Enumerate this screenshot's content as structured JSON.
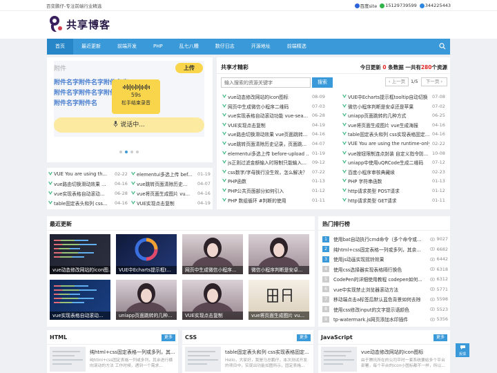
{
  "topbar": {
    "slogan": "百变鹏仔-专注前端行业精选",
    "baidu": "百度site",
    "wechat": "15129739599",
    "qq": "344225443"
  },
  "logo": {
    "text": "共享博客"
  },
  "nav": {
    "items": [
      "首页",
      "最近更新",
      "前端开发",
      "PHP",
      "乱七八糟",
      "数仔日志",
      "开源地址",
      "前端精选"
    ],
    "active_index": 0
  },
  "slider": {
    "attach_title": "附件",
    "attach_lines": [
      "附件名字附件名字附件名字",
      "附件名字附件名字附件",
      "附件名字附件名"
    ],
    "upload_label": "上传",
    "rec_time": "59s",
    "rec_hint": "松手结束录音",
    "talk_label": "说话中...",
    "dots": 4,
    "active_dot": 1
  },
  "mini_list": [
    {
      "title": "VUE You are using th...",
      "date": "02-22"
    },
    {
      "title": "elementui多选上传 bef...",
      "date": "01-19"
    },
    {
      "title": "vue路由切换滑动效果 ...",
      "date": "04-16"
    },
    {
      "title": "vue跳转页面清除历史...",
      "date": "04-07"
    },
    {
      "title": "vue实现表格自动滚动...",
      "date": "06-28"
    },
    {
      "title": "vue将页面生成图片 vu...",
      "date": "04-16"
    },
    {
      "title": "table固定表头和列 css...",
      "date": "04-16"
    },
    {
      "title": "VUE实现点击复制",
      "date": "04-19"
    }
  ],
  "share": {
    "title": "共享才精彩",
    "stat_pre": "今日更新 ",
    "stat_today": "0",
    "stat_mid": " 条数据 一共有",
    "stat_total": "280",
    "stat_post": "个资源",
    "search_placeholder": "输入搜索的资源关键字",
    "search_button": "搜索",
    "prev": "上一页",
    "page": "1/5",
    "next": "下一页",
    "left_items": [
      {
        "title": "vue动态修改网站的icon图标",
        "date": "08-09"
      },
      {
        "title": "网页中生成微信小程序二维码",
        "date": "07-03"
      },
      {
        "title": "vue实现表格自动滚动功能 vue-sea...",
        "date": "06-28"
      },
      {
        "title": "VUE实现点击复制",
        "date": "04-19"
      },
      {
        "title": "vue路由切换滑动效果 vue页面跳转...",
        "date": "04-16"
      },
      {
        "title": "vue跳转页面清除历史记录，页面跳...",
        "date": "04-07"
      },
      {
        "title": "elementui多选上传 before-upload ...",
        "date": "01-19"
      },
      {
        "title": "js正则过滤金额输入时限制只能输入...",
        "date": "09-12"
      },
      {
        "title": "css数字/字母换行没生效，怎么解决？",
        "date": "07-22"
      },
      {
        "title": "PHP函数",
        "date": "01-13"
      },
      {
        "title": "PHP公共页面部分如何引入",
        "date": "01-12"
      },
      {
        "title": "PHP 数组循环 #判断的使用",
        "date": "01-11"
      }
    ],
    "right_items": [
      {
        "title": "VUE中Echarts提示框tooltip自动切换",
        "date": "07-08"
      },
      {
        "title": "微信小程序判断是安卓还是苹果",
        "date": "07-02"
      },
      {
        "title": "uniapp页面跳转的几种方式",
        "date": "06-25"
      },
      {
        "title": "vue将页面生成图片 vue生成海报",
        "date": "04-16"
      },
      {
        "title": "table固定表头和列 css实现表格固定...",
        "date": "04-16"
      },
      {
        "title": "VUE You are using the runtime-only...",
        "date": "02-22"
      },
      {
        "title": "vue按钮限制连点封装 自定义指令防...",
        "date": "10-08"
      },
      {
        "title": "uniapp中使用uQRCode生成二维码",
        "date": "07-12"
      },
      {
        "title": "百度小程序审核典藏续",
        "date": "02-23"
      },
      {
        "title": "PHP 字符串函数",
        "date": "01-13"
      },
      {
        "title": "http请求类型 POST请求",
        "date": "01-12"
      },
      {
        "title": "http请求类型 GET请求",
        "date": "01-11"
      }
    ]
  },
  "latest": {
    "title": "最近更新",
    "thumbs": [
      "vue动态修改网站的icon图...",
      "VUE中Echarts提示框t...",
      "网页中生成微信小程序...",
      "微信小程序判断是安卓...",
      "vue实现表格自动滚动...",
      "uniapp页面跳转的几种...",
      "VUE实现点击复制",
      "vue将页面生成图片 vu..."
    ]
  },
  "hot": {
    "title": "热门排行榜",
    "items": [
      {
        "title": "使用bat自动执行cmd命令（多个命令或...",
        "count": "9027"
      },
      {
        "title": "纯html+css固定表格一列或多列，其余...",
        "count": "6682"
      },
      {
        "title": "使用js动画实现摇铃效果",
        "count": "6442"
      },
      {
        "title": "使用css选择器实现表格隔行换色",
        "count": "6318"
      },
      {
        "title": "CodePen的详细使用教程 codepen如何...",
        "count": "6312"
      },
      {
        "title": "vue中实现禁止浏览器滚动方法",
        "count": "5771"
      },
      {
        "title": "移动端点击a标签后默认蓝色背景如何去除",
        "count": "5598"
      },
      {
        "title": "使用css修改input的文字提示语颜色",
        "count": "5523"
      },
      {
        "title": "tp-watermark.js网页添加水印插件",
        "count": "5356"
      }
    ]
  },
  "bottom": [
    {
      "title": "HTML",
      "more": "更多",
      "item_title": "纯html+css固定表格一列或多列，其...",
      "item_desc": "纯html+css固定表格一列或多列，其余进行横向滚动的方法 工作时候，遇到一个需求..."
    },
    {
      "title": "CSS",
      "more": "更多",
      "item_title": "table固定表头和列 css实现表格固定...",
      "item_desc": "Hello，大家好，我是马总鹏仔，本次测试开发的项目中，实现出功能如图所示，固定表格..."
    },
    {
      "title": "JavaScript",
      "more": "更多",
      "item_title": "vue动态修改网站的icon图标",
      "item_desc": "由于腾讯所在的公司平时一套系统要给多个平台部署，每个平台的icon小图标都不一样，所以..."
    }
  ],
  "fab": {
    "label": "反馈"
  }
}
